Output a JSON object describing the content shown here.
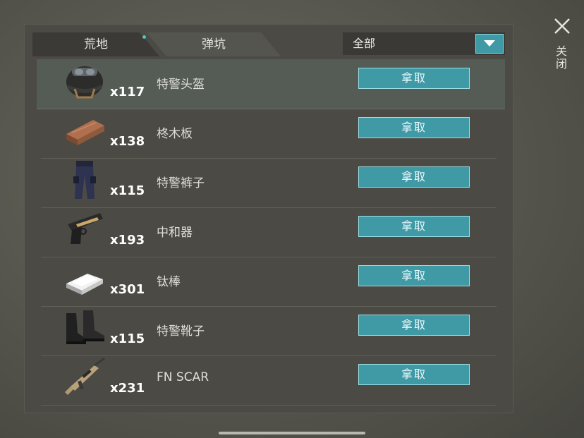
{
  "tabs": [
    {
      "label": "荒地",
      "active": true
    },
    {
      "label": "弹坑",
      "active": false
    }
  ],
  "filter": {
    "selected": "全部"
  },
  "close": {
    "label": "关闭"
  },
  "colors": {
    "accent": "#3f9aa6",
    "panel": "#4b4a45"
  },
  "items": [
    {
      "name": "特警头盔",
      "qty": "x117",
      "action": "拿取",
      "icon": "helmet-icon"
    },
    {
      "name": "柊木板",
      "qty": "x138",
      "action": "拿取",
      "icon": "wood-plank-icon"
    },
    {
      "name": "特警裤子",
      "qty": "x115",
      "action": "拿取",
      "icon": "pants-icon"
    },
    {
      "name": "中和器",
      "qty": "x193",
      "action": "拿取",
      "icon": "pistol-icon"
    },
    {
      "name": "钛棒",
      "qty": "x301",
      "action": "拿取",
      "icon": "ingot-icon"
    },
    {
      "name": "特警靴子",
      "qty": "x115",
      "action": "拿取",
      "icon": "boots-icon"
    },
    {
      "name": "FN SCAR",
      "qty": "x231",
      "action": "拿取",
      "icon": "rifle-icon"
    }
  ]
}
